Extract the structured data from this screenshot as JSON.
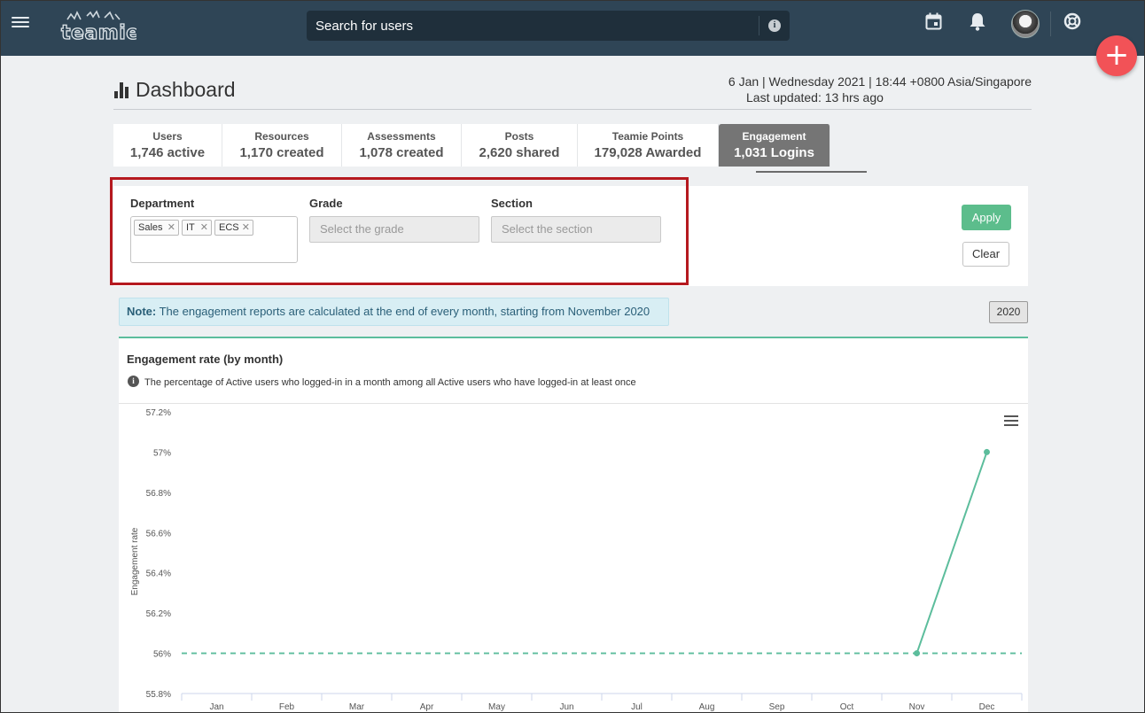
{
  "topbar": {
    "search_placeholder": "Search for users"
  },
  "header": {
    "title": "Dashboard",
    "date_line": "6 Jan | Wednesday 2021 | 18:44 +0800 Asia/Singapore",
    "last_updated": "Last updated: 13 hrs ago"
  },
  "tabs": [
    {
      "label": "Users",
      "value": "1,746 active"
    },
    {
      "label": "Resources",
      "value": "1,170 created"
    },
    {
      "label": "Assessments",
      "value": "1,078 created"
    },
    {
      "label": "Posts",
      "value": "2,620 shared"
    },
    {
      "label": "Teamie Points",
      "value": "179,028 Awarded"
    },
    {
      "label": "Engagement",
      "value": "1,031 Logins",
      "active": true
    }
  ],
  "filters": {
    "department_label": "Department",
    "department_chips": [
      "Sales",
      "IT",
      "ECS"
    ],
    "grade_label": "Grade",
    "grade_placeholder": "Select the grade",
    "section_label": "Section",
    "section_placeholder": "Select the section",
    "apply_label": "Apply",
    "clear_label": "Clear"
  },
  "note": {
    "prefix": "Note:",
    "text": "The engagement reports are calculated at the end of every month, starting from November 2020"
  },
  "year_button": "2020",
  "chart": {
    "title": "Engagement rate (by month)",
    "description": "The percentage of Active users who logged-in in a month among all Active users who have logged-in at least once"
  },
  "colors": {
    "topbar": "#2f4556",
    "accent_green": "#5cbd8c",
    "series": "#5cbd9c",
    "fab": "#f25257",
    "highlight": "#b5191f"
  },
  "chart_data": {
    "type": "line",
    "ylabel": "Engagement rate",
    "categories": [
      "Jan",
      "Feb",
      "Mar",
      "Apr",
      "May",
      "Jun",
      "Jul",
      "Aug",
      "Sep",
      "Oct",
      "Nov",
      "Dec"
    ],
    "y_tick_labels": [
      "57.2%",
      "57%",
      "56.8%",
      "56.6%",
      "56.4%",
      "56.2%",
      "56%",
      "55.8%"
    ],
    "y_ticks": [
      57.2,
      57.0,
      56.8,
      56.6,
      56.4,
      56.2,
      56.0,
      55.8
    ],
    "ylim": [
      55.8,
      57.2
    ],
    "series": [
      {
        "values": [
          null,
          null,
          null,
          null,
          null,
          null,
          null,
          null,
          null,
          null,
          56,
          57
        ]
      }
    ],
    "reference_line": {
      "value": 56,
      "style": "dashed"
    },
    "grid": false
  }
}
